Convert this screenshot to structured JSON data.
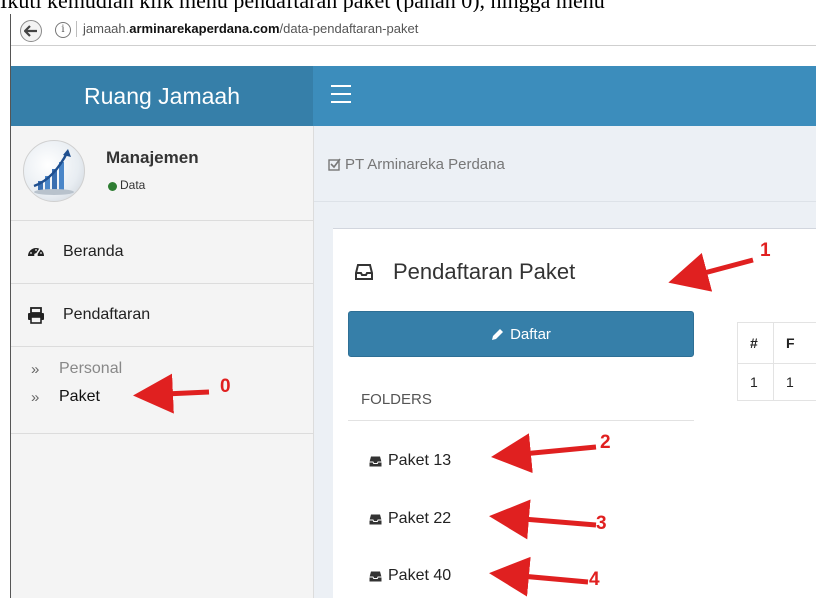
{
  "caption": "Ikuti kemudian klik menu pendaftaran paket (panah 0), hingga menu",
  "browser": {
    "url_host_prefix": "jamaah.",
    "url_host_domain": "arminarekaperdana.com",
    "url_path": "/data-pendaftaran-paket"
  },
  "sidebar": {
    "brand": "Ruang Jamaah",
    "user_name": "Manajemen",
    "status": "Data",
    "menu": [
      {
        "label": "Beranda",
        "icon": "dashboard-icon"
      },
      {
        "label": "Pendaftaran",
        "icon": "printer-icon"
      }
    ],
    "submenu": [
      {
        "label": "Personal"
      },
      {
        "label": "Paket"
      }
    ],
    "submenu_marker": "»"
  },
  "content": {
    "breadcrumb": "PT Arminareka Perdana",
    "box_title": "Pendaftaran Paket",
    "daftar_button": "Daftar",
    "folders_label": "FOLDERS",
    "folders": [
      {
        "label": "Paket 13"
      },
      {
        "label": "Paket 22"
      },
      {
        "label": "Paket 40"
      }
    ],
    "table": {
      "headers": [
        "#",
        "F"
      ],
      "rows": [
        [
          "1",
          "1"
        ]
      ]
    }
  },
  "annotations": {
    "numbers": [
      "0",
      "1",
      "2",
      "3",
      "4"
    ],
    "color": "#e02020"
  },
  "colors": {
    "brand_dark": "#367fa9",
    "brand": "#3c8dbc",
    "content_bg": "#ecf0f5",
    "status_green": "#2e7d32"
  }
}
